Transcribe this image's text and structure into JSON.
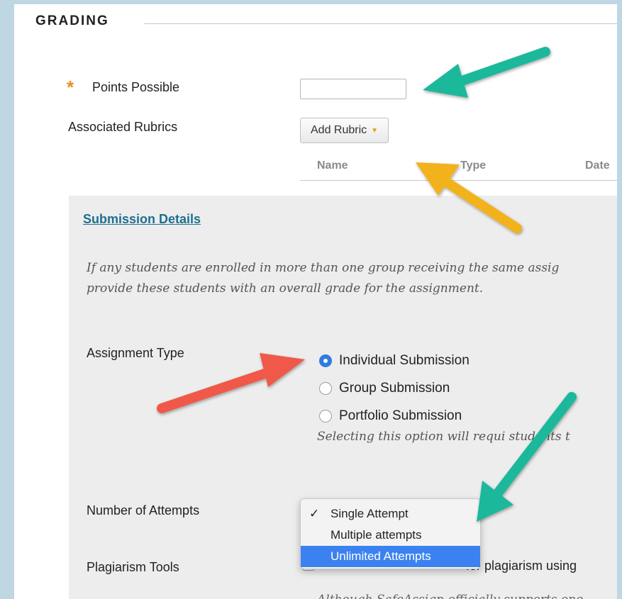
{
  "heading": {
    "title": "GRADING"
  },
  "points": {
    "required_marker": "*",
    "label": "Points Possible",
    "value": ""
  },
  "rubrics": {
    "label": "Associated Rubrics",
    "add_button": "Add Rubric",
    "columns": [
      "Name",
      "Type",
      "Date"
    ]
  },
  "submission": {
    "link": "Submission Details",
    "note_line1": "If any students are enrolled in more than one group receiving the same assig",
    "note_line2": "provide these students with an overall grade for the assignment.",
    "assignment_type_label": "Assignment Type",
    "options": [
      {
        "label": "Individual Submission",
        "checked": true
      },
      {
        "label": "Group Submission",
        "checked": false
      },
      {
        "label": "Portfolio Submission",
        "checked": false
      }
    ],
    "portfolio_note": "Selecting this option will requi     students t",
    "attempts_label": "Number of Attempts",
    "attempts_options": [
      {
        "label": "Single Attempt",
        "checked": true,
        "highlighted": false
      },
      {
        "label": "Multiple attempts",
        "checked": false,
        "highlighted": false
      },
      {
        "label": "Unlimited Attempts",
        "checked": false,
        "highlighted": true
      }
    ],
    "plagiarism_label": "Plagiarism Tools",
    "plagiarism_text": "for plagiarism using",
    "safeassign_note": "Although SafeAssign officially supports one"
  },
  "colors": {
    "teal_arrow": "#1fb89b",
    "yellow_arrow": "#f2b21b",
    "red_arrow": "#f0584a",
    "link": "#1e6f8f",
    "required": "#f08b1f",
    "selection": "#3b82f0"
  }
}
